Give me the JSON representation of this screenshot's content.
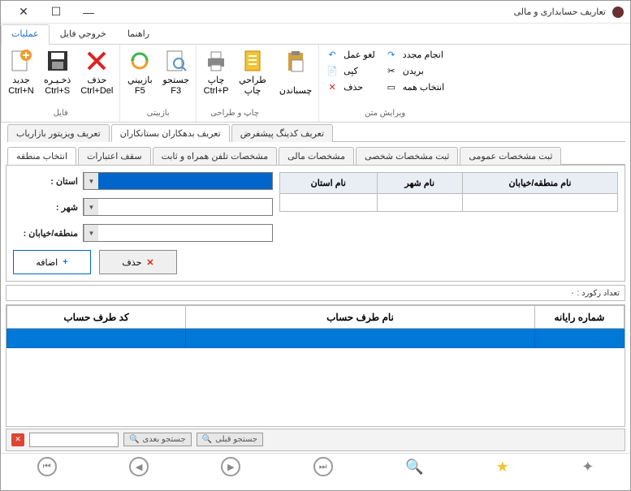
{
  "window": {
    "title": "تعاریف حسابداری و مالی"
  },
  "menu": {
    "tabs": [
      "عملیات",
      "خروجي فايل",
      "راهنما"
    ]
  },
  "ribbon": {
    "groups": [
      {
        "label": "فایل",
        "items": [
          {
            "text": "جديد\nCtrl+N",
            "icon": "new"
          },
          {
            "text": "ذخـيـره\nCtrl+S",
            "icon": "save"
          },
          {
            "text": "حذف\nCtrl+Del",
            "icon": "delete"
          }
        ]
      },
      {
        "label": "بازبیتی",
        "items": [
          {
            "text": "بازييني\nF5",
            "icon": "refresh"
          },
          {
            "text": "جستجو\nF3",
            "icon": "search"
          }
        ]
      },
      {
        "label": "چاپ و طراحی",
        "items": [
          {
            "text": "چاپ\nCtrl+P",
            "icon": "print"
          },
          {
            "text": "طراحي\nچاپ",
            "icon": "design"
          }
        ]
      },
      {
        "label": "",
        "items": [
          {
            "text": "\nچسباندن",
            "icon": "paste"
          }
        ]
      },
      {
        "label": "ویرایش متن",
        "small": [
          {
            "text": "لغو عمل",
            "icon": "undo"
          },
          {
            "text": "کپی",
            "icon": "copy"
          },
          {
            "text": "حذف",
            "icon": "del"
          }
        ],
        "small2": [
          {
            "text": "انجام مجدد",
            "icon": "redo"
          },
          {
            "text": "بریدن",
            "icon": "cut"
          },
          {
            "text": "انتخاب همه",
            "icon": "selectall"
          }
        ]
      }
    ]
  },
  "top_tabs": [
    "تعریف ویزیتور بازاریاب",
    "تعریف بدهکاران بستانکاران",
    "تعریف کدینگ پیشفرض"
  ],
  "sub_tabs": [
    "انتخاب منطقه",
    "سقف اعتبارات",
    "مشخصات تلفن همراه و ثابت",
    "مشخصات مالی",
    "ثبت مشخصات شخصی",
    "ثبت مشخصات عمومی"
  ],
  "form": {
    "labels": {
      "province": "استان :",
      "city": "شهر :",
      "region": "منطقه/خیابان :"
    },
    "buttons": {
      "add": "اضافه",
      "del": "حذف"
    }
  },
  "mini_cols": [
    "نام منطقه/خیابان",
    "نام شهر",
    "نام استان"
  ],
  "record_label": "تعداد رکورد : ٠",
  "main_cols": [
    "شماره رایانه",
    "نام طرف حساب",
    "کد طرف حساب"
  ],
  "search": {
    "next": "جستجو بعدی",
    "prev": "جستجو قبلی"
  }
}
